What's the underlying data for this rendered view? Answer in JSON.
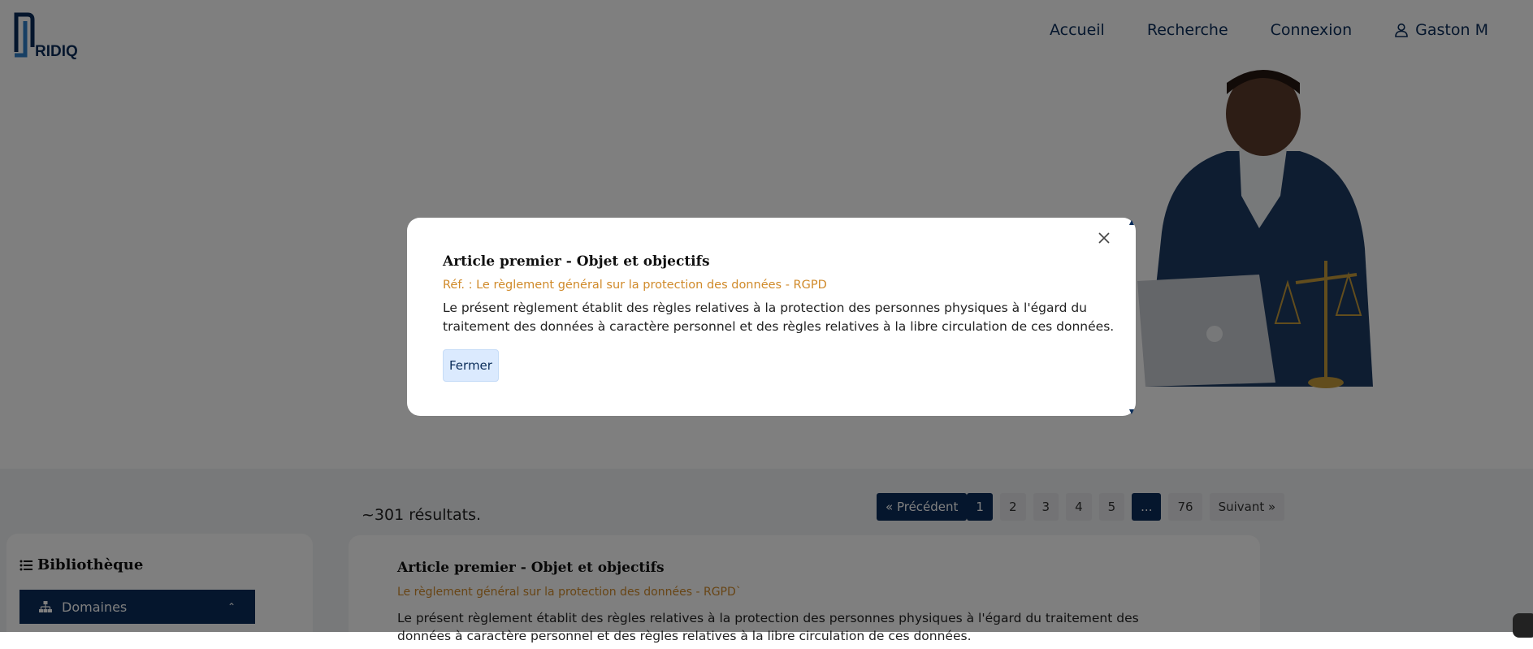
{
  "brand": {
    "logo_text": "RIDIQ"
  },
  "nav": {
    "items": [
      {
        "label": "Accueil"
      },
      {
        "label": "Recherche"
      },
      {
        "label": "Connexion"
      }
    ],
    "user": {
      "label": "Gaston M",
      "icon": "user-icon"
    }
  },
  "results": {
    "count_label": "~301 résultats."
  },
  "pagination": {
    "prev": "« Précédent",
    "pages": [
      "1",
      "2",
      "3",
      "4",
      "5"
    ],
    "ellipsis": "...",
    "last": "76",
    "next": "Suivant »",
    "current": "1"
  },
  "sidebar": {
    "title": "Bibliothèque",
    "domain_label": "Domaines"
  },
  "result_card": {
    "title": "Article premier - Objet et objectifs",
    "ref": "Le règlement général sur la protection des données - RGPD`",
    "text": "Le présent règlement établit des règles relatives à la protection des personnes physiques à l'égard du traitement des données à caractère personnel et des règles relatives à la libre circulation de ces données."
  },
  "modal": {
    "title": "Article premier - Objet et objectifs",
    "ref": "Réf. : Le règlement général sur la protection des données - RGPD",
    "text": "Le présent règlement établit des règles relatives à la protection des personnes physiques à l'égard du traitement des données à caractère personnel et des règles relatives à la libre circulation de ces données.",
    "close_button": "Fermer"
  },
  "colors": {
    "primary": "#0b2d5a",
    "accent": "#d08a2a",
    "button_bg": "#dbeafe"
  }
}
